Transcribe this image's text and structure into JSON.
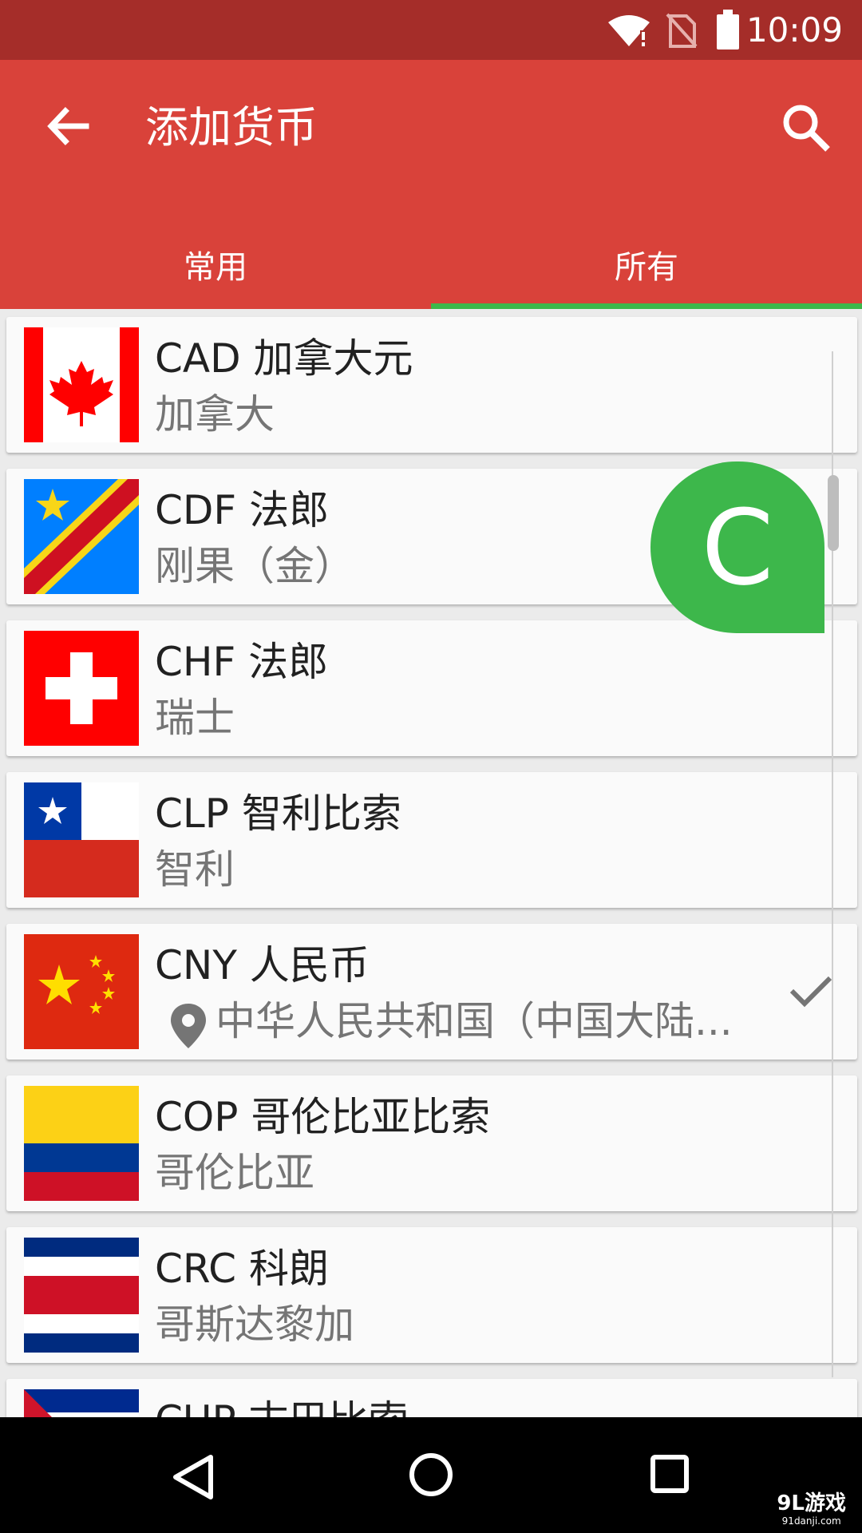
{
  "status_bar": {
    "time": "10:09",
    "icons": [
      "wifi-alert-icon",
      "no-sim-icon",
      "battery-icon"
    ]
  },
  "app_bar": {
    "title": "添加货币",
    "back_icon": "arrow-back-icon",
    "search_icon": "search-icon"
  },
  "tabs": [
    {
      "label": "常用",
      "active": false
    },
    {
      "label": "所有",
      "active": true
    }
  ],
  "accent_colors": {
    "app_bar": "#d9423a",
    "status_bar": "#a52d29",
    "tab_indicator": "#3db74b",
    "section_bubble": "#3db74b"
  },
  "section_bubble": {
    "letter": "C"
  },
  "currencies": [
    {
      "code_name": "CAD 加拿大元",
      "country": "加拿大",
      "flag": "canada-flag"
    },
    {
      "code_name": "CDF 法郎",
      "country": "刚果（金）",
      "flag": "dr-congo-flag"
    },
    {
      "code_name": "CHF 法郎",
      "country": "瑞士",
      "flag": "switzerland-flag"
    },
    {
      "code_name": "CLP 智利比索",
      "country": "智利",
      "flag": "chile-flag"
    },
    {
      "code_name": "CNY 人民币",
      "country": "中华人民共和国（中国大陆...",
      "flag": "china-flag",
      "current_location": true,
      "selected": true
    },
    {
      "code_name": "COP 哥伦比亚比索",
      "country": "哥伦比亚",
      "flag": "colombia-flag"
    },
    {
      "code_name": "CRC 科朗",
      "country": "哥斯达黎加",
      "flag": "costa-rica-flag"
    },
    {
      "code_name": "CUP 古巴比索",
      "country": "",
      "flag": "cuba-flag"
    }
  ],
  "nav_bar": {
    "icons": [
      "back-triangle-icon",
      "home-circle-icon",
      "recents-square-icon"
    ]
  },
  "watermark": {
    "main": "9L游戏",
    "sub": "91danji.com"
  }
}
